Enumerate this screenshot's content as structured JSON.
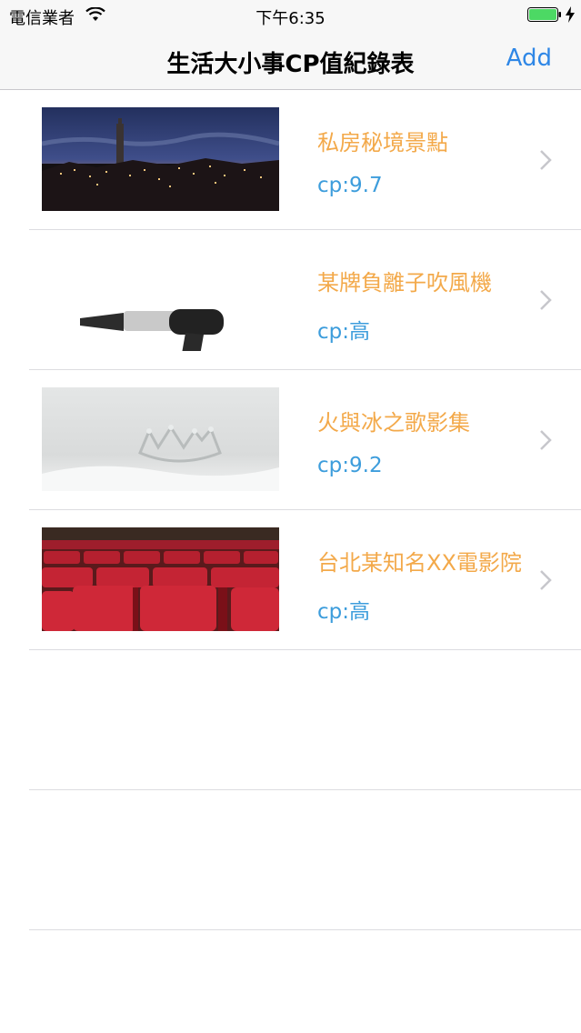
{
  "status_bar": {
    "carrier": "電信業者",
    "time": "下午6:35",
    "wifi_icon": "wifi-icon",
    "battery_icon": "battery-icon",
    "charging_icon": "charging-bolt-icon",
    "battery_color": "#4cd964"
  },
  "nav": {
    "title": "生活大小事CP值紀錄表",
    "add_label": "Add",
    "accent_color": "#2f87e6"
  },
  "items": [
    {
      "title": "私房秘境景點",
      "cp": "cp:9.7",
      "image": "city-night-skyline"
    },
    {
      "title": "某牌負離子吹風機",
      "cp": "cp:高",
      "image": "hair-dryer"
    },
    {
      "title": "火與冰之歌影集",
      "cp": "cp:9.2",
      "image": "silver-crown"
    },
    {
      "title": "台北某知名XX電影院",
      "cp": "cp:高",
      "image": "red-theater-seats"
    }
  ],
  "colors": {
    "title_color": "#f3a94a",
    "cp_color": "#3d9ddc"
  }
}
